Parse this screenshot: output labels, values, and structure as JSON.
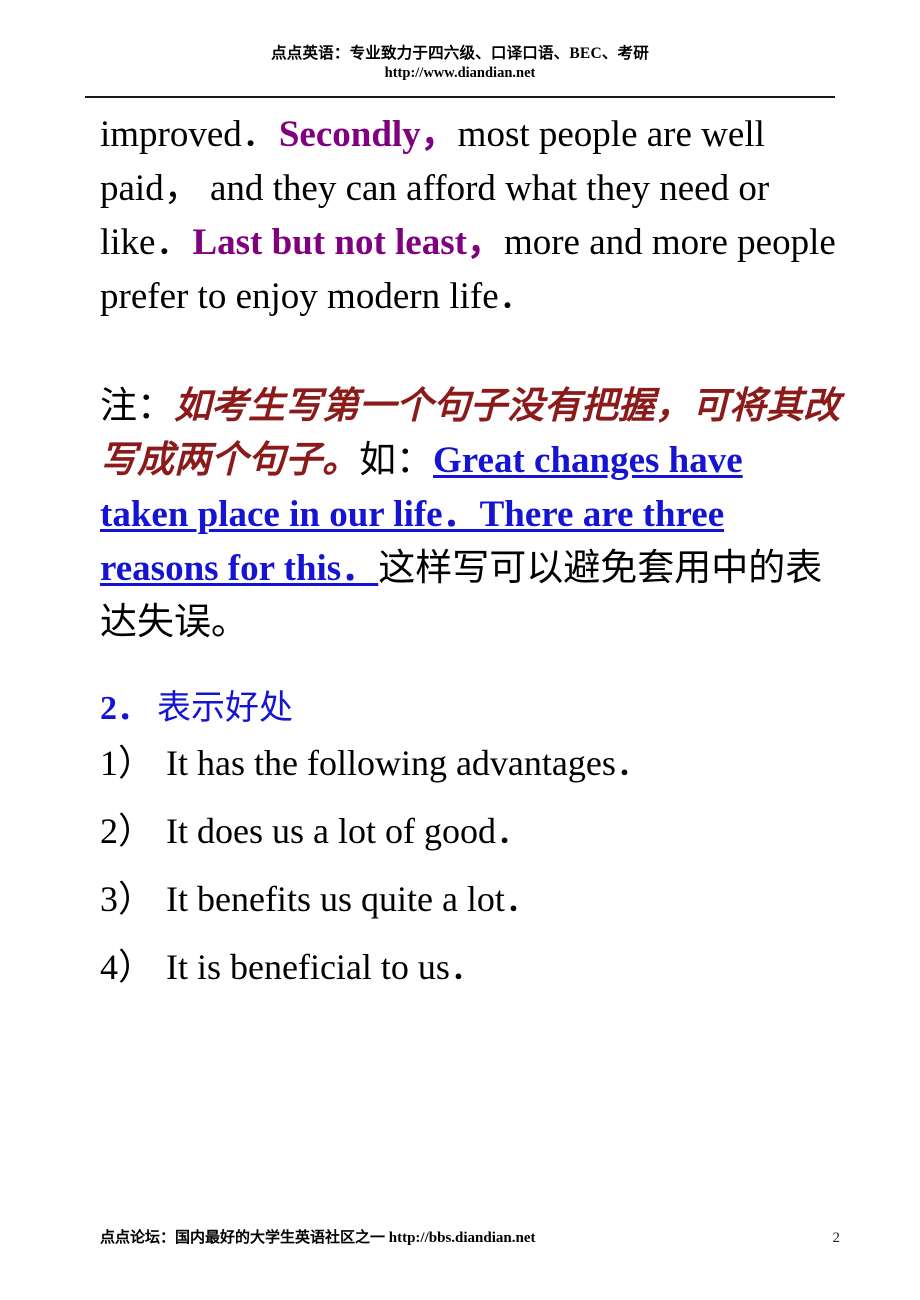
{
  "header": {
    "line1": "点点英语：专业致力于四六级、口译口语、BEC、考研",
    "line2": "http://www.diandian.net"
  },
  "body": {
    "paragraph1": {
      "run1": "improved．",
      "run2_highlight": "Secondly，",
      "run3": "most people are well paid，   and they can afford what they need or like．",
      "run4_highlight": "Last but not least，",
      "run5": "more and more people prefer to enjoy modern life．"
    },
    "note": {
      "label": "注：",
      "red_italic": "如考生写第一个句子没有把握，可将其改写成两个句子。",
      "mid": "如：",
      "link_text": "Great changes have taken place in our life．There are three reasons for this．",
      "tail": "这样写可以避免套用中的表达失误。"
    },
    "section": {
      "number": "2．",
      "title": "表示好处"
    },
    "list": [
      {
        "marker": "1）",
        "text": "It has the following advantages．"
      },
      {
        "marker": "2）",
        "text": "It does us a lot of good．"
      },
      {
        "marker": "3）",
        "text": "It benefits us quite a lot．"
      },
      {
        "marker": "4）",
        "text": "It is beneficial to us．"
      }
    ]
  },
  "footer": {
    "text": "点点论坛：国内最好的大学生英语社区之一 http://bbs.diandian.net",
    "page_number": "2"
  },
  "colors": {
    "highlight_purple": "#800080",
    "note_red": "#8B1A1A",
    "link_blue": "#1414D2",
    "text_black": "#000000"
  }
}
